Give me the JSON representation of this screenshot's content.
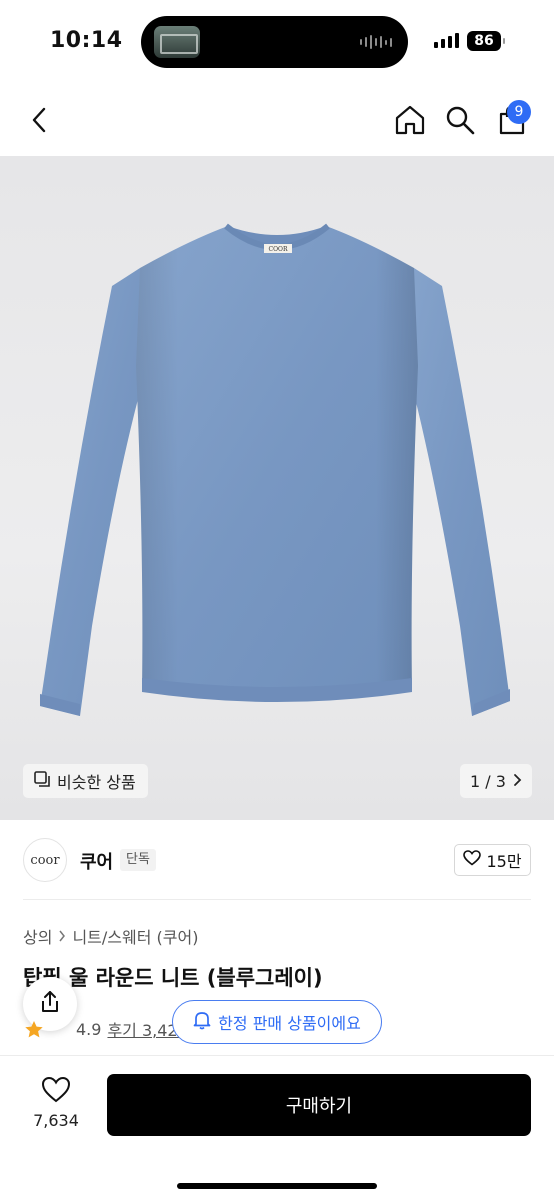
{
  "status_bar": {
    "time": "10:14",
    "battery": "86"
  },
  "header": {
    "cart_count": "9"
  },
  "gallery": {
    "garment_label": "COOR",
    "similar_label": "비슷한 상품",
    "pager": "1 / 3"
  },
  "brand": {
    "logo_text": "coor",
    "name": "쿠어",
    "tag": "단독",
    "likes": "15만"
  },
  "product": {
    "breadcrumb": [
      "상의",
      "니트/스웨터 (쿠어)"
    ],
    "title": "탑필 울 라운드 니트 (블루그레이)",
    "rating": "4.9",
    "review_label": "후기 3,429개"
  },
  "notice": {
    "limited_label": "한정 판매 상품이에요"
  },
  "bottom_bar": {
    "wish_count": "7,634",
    "buy_label": "구매하기"
  },
  "colors": {
    "accent": "#2f6cf5",
    "sweater": "#7b9bc4",
    "buy_button": "#000000"
  },
  "icons": [
    "back-icon",
    "home-icon",
    "search-icon",
    "bag-icon",
    "similar-icon",
    "chevron-right-icon",
    "heart-icon",
    "share-icon",
    "bell-icon",
    "star-icon"
  ]
}
